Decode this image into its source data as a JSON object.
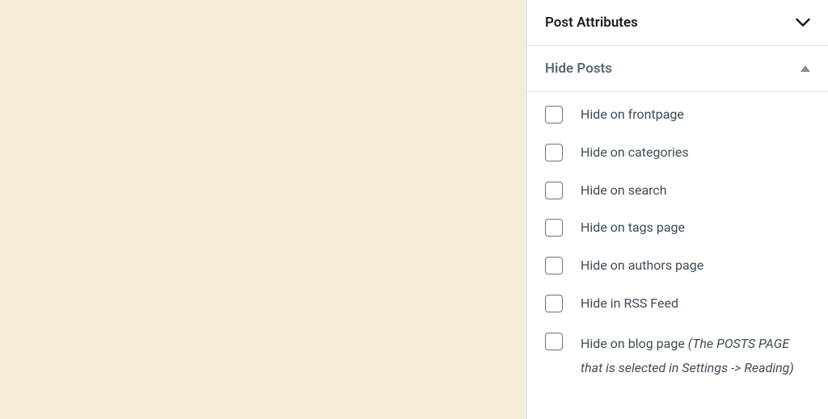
{
  "panels": {
    "post_attributes": {
      "title": "Post Attributes",
      "expanded": false
    },
    "hide_posts": {
      "title": "Hide Posts",
      "expanded": true,
      "options": [
        {
          "label": "Hide on frontpage",
          "checked": false
        },
        {
          "label": "Hide on categories",
          "checked": false
        },
        {
          "label": "Hide on search",
          "checked": false
        },
        {
          "label": "Hide on tags page",
          "checked": false
        },
        {
          "label": "Hide on authors page",
          "checked": false
        },
        {
          "label": "Hide in RSS Feed",
          "checked": false
        }
      ],
      "last_option": {
        "label": "Hide on blog page ",
        "note": "(The POSTS PAGE that is selected in Settings -> Reading)",
        "checked": false
      }
    }
  }
}
